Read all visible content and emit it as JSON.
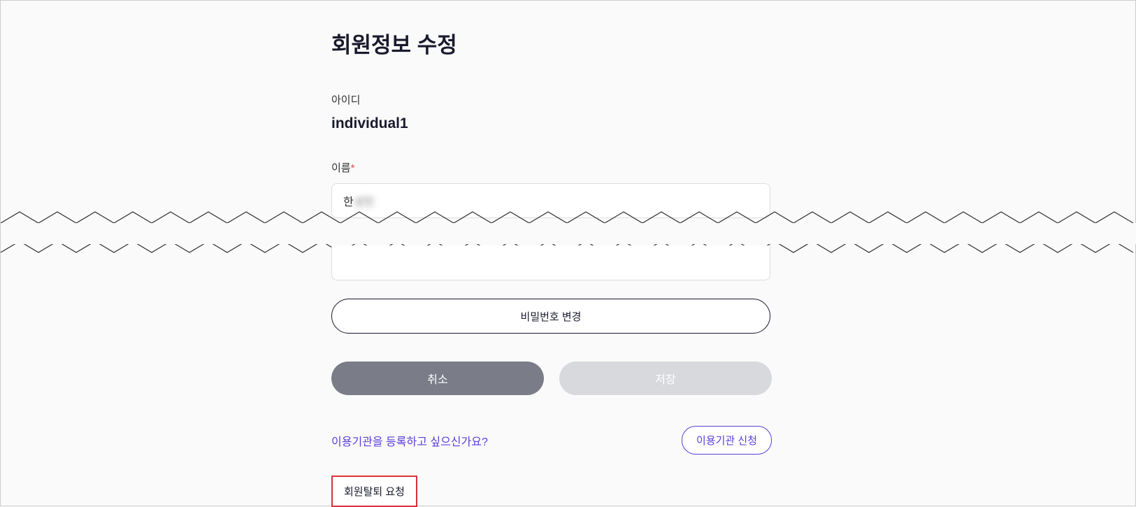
{
  "title": "회원정보 수정",
  "id": {
    "label": "아이디",
    "value": "individual1"
  },
  "name": {
    "label": "이름",
    "required_mark": "*",
    "value_visible": "한",
    "value_obscured": "성민"
  },
  "password_button": "비밀번호 변경",
  "cancel": "취소",
  "save": "저장",
  "register_prompt": "이용기관을 등록하고 싶으신가요?",
  "apply_org": "이용기관 신청",
  "withdraw": "회원탈퇴 요청"
}
